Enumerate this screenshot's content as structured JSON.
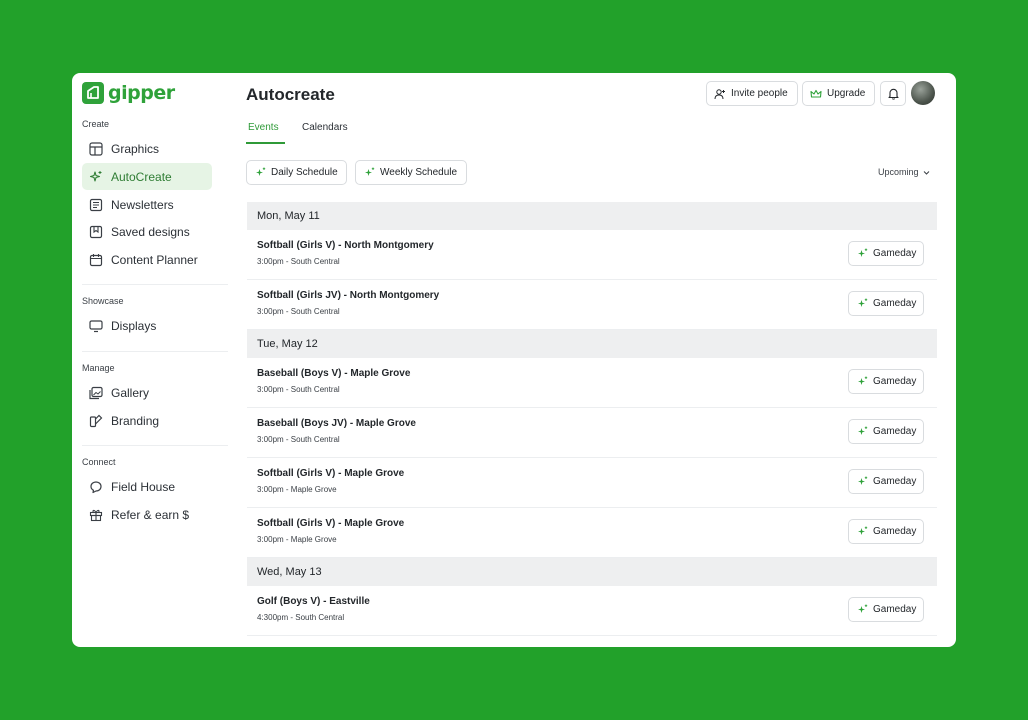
{
  "app": {
    "name": "gipper"
  },
  "sidebar": {
    "sections": [
      {
        "label": "Create",
        "items": [
          {
            "label": "Graphics",
            "icon": "layout-icon"
          },
          {
            "label": "AutoCreate",
            "icon": "sparkle-icon",
            "active": true
          },
          {
            "label": "Newsletters",
            "icon": "newsletter-icon"
          },
          {
            "label": "Saved designs",
            "icon": "bookmark-icon"
          },
          {
            "label": "Content Planner",
            "icon": "calendar-icon"
          }
        ]
      },
      {
        "label": "Showcase",
        "items": [
          {
            "label": "Displays",
            "icon": "monitor-icon"
          }
        ]
      },
      {
        "label": "Manage",
        "items": [
          {
            "label": "Gallery",
            "icon": "gallery-icon"
          },
          {
            "label": "Branding",
            "icon": "branding-icon"
          }
        ]
      },
      {
        "label": "Connect",
        "items": [
          {
            "label": "Field House",
            "icon": "chat-icon"
          },
          {
            "label": "Refer & earn $",
            "icon": "gift-icon"
          }
        ]
      }
    ]
  },
  "header": {
    "title": "Autocreate",
    "invite_label": "Invite people",
    "upgrade_label": "Upgrade"
  },
  "tabs": [
    {
      "label": "Events",
      "active": true
    },
    {
      "label": "Calendars",
      "active": false
    }
  ],
  "toolbar": {
    "daily_label": "Daily Schedule",
    "weekly_label": "Weekly Schedule",
    "filter_label": "Upcoming"
  },
  "colors": {
    "accent": "#2fa23a",
    "background": "#22a12a",
    "active_bg": "#e6f4e5"
  },
  "days": [
    {
      "date": "Mon, May 11",
      "events": [
        {
          "title": "Softball (Girls V) - North Montgomery",
          "sub": "3:00pm - South Central",
          "action": "Gameday"
        },
        {
          "title": "Softball (Girls JV) - North Montgomery",
          "sub": "3:00pm - South Central",
          "action": "Gameday"
        }
      ]
    },
    {
      "date": "Tue, May 12",
      "events": [
        {
          "title": "Baseball (Boys V) - Maple Grove",
          "sub": "3:00pm - South Central",
          "action": "Gameday"
        },
        {
          "title": "Baseball (Boys JV) - Maple Grove",
          "sub": "3:00pm - South Central",
          "action": "Gameday"
        },
        {
          "title": "Softball (Girls V) - Maple Grove",
          "sub": "3:00pm - Maple Grove",
          "action": "Gameday"
        },
        {
          "title": "Softball (Girls V) - Maple Grove",
          "sub": "3:00pm - Maple Grove",
          "action": "Gameday"
        }
      ]
    },
    {
      "date": "Wed, May 13",
      "events": [
        {
          "title": "Golf (Boys V) - Eastville",
          "sub": "4:300pm - South Central",
          "action": "Gameday"
        }
      ]
    }
  ]
}
